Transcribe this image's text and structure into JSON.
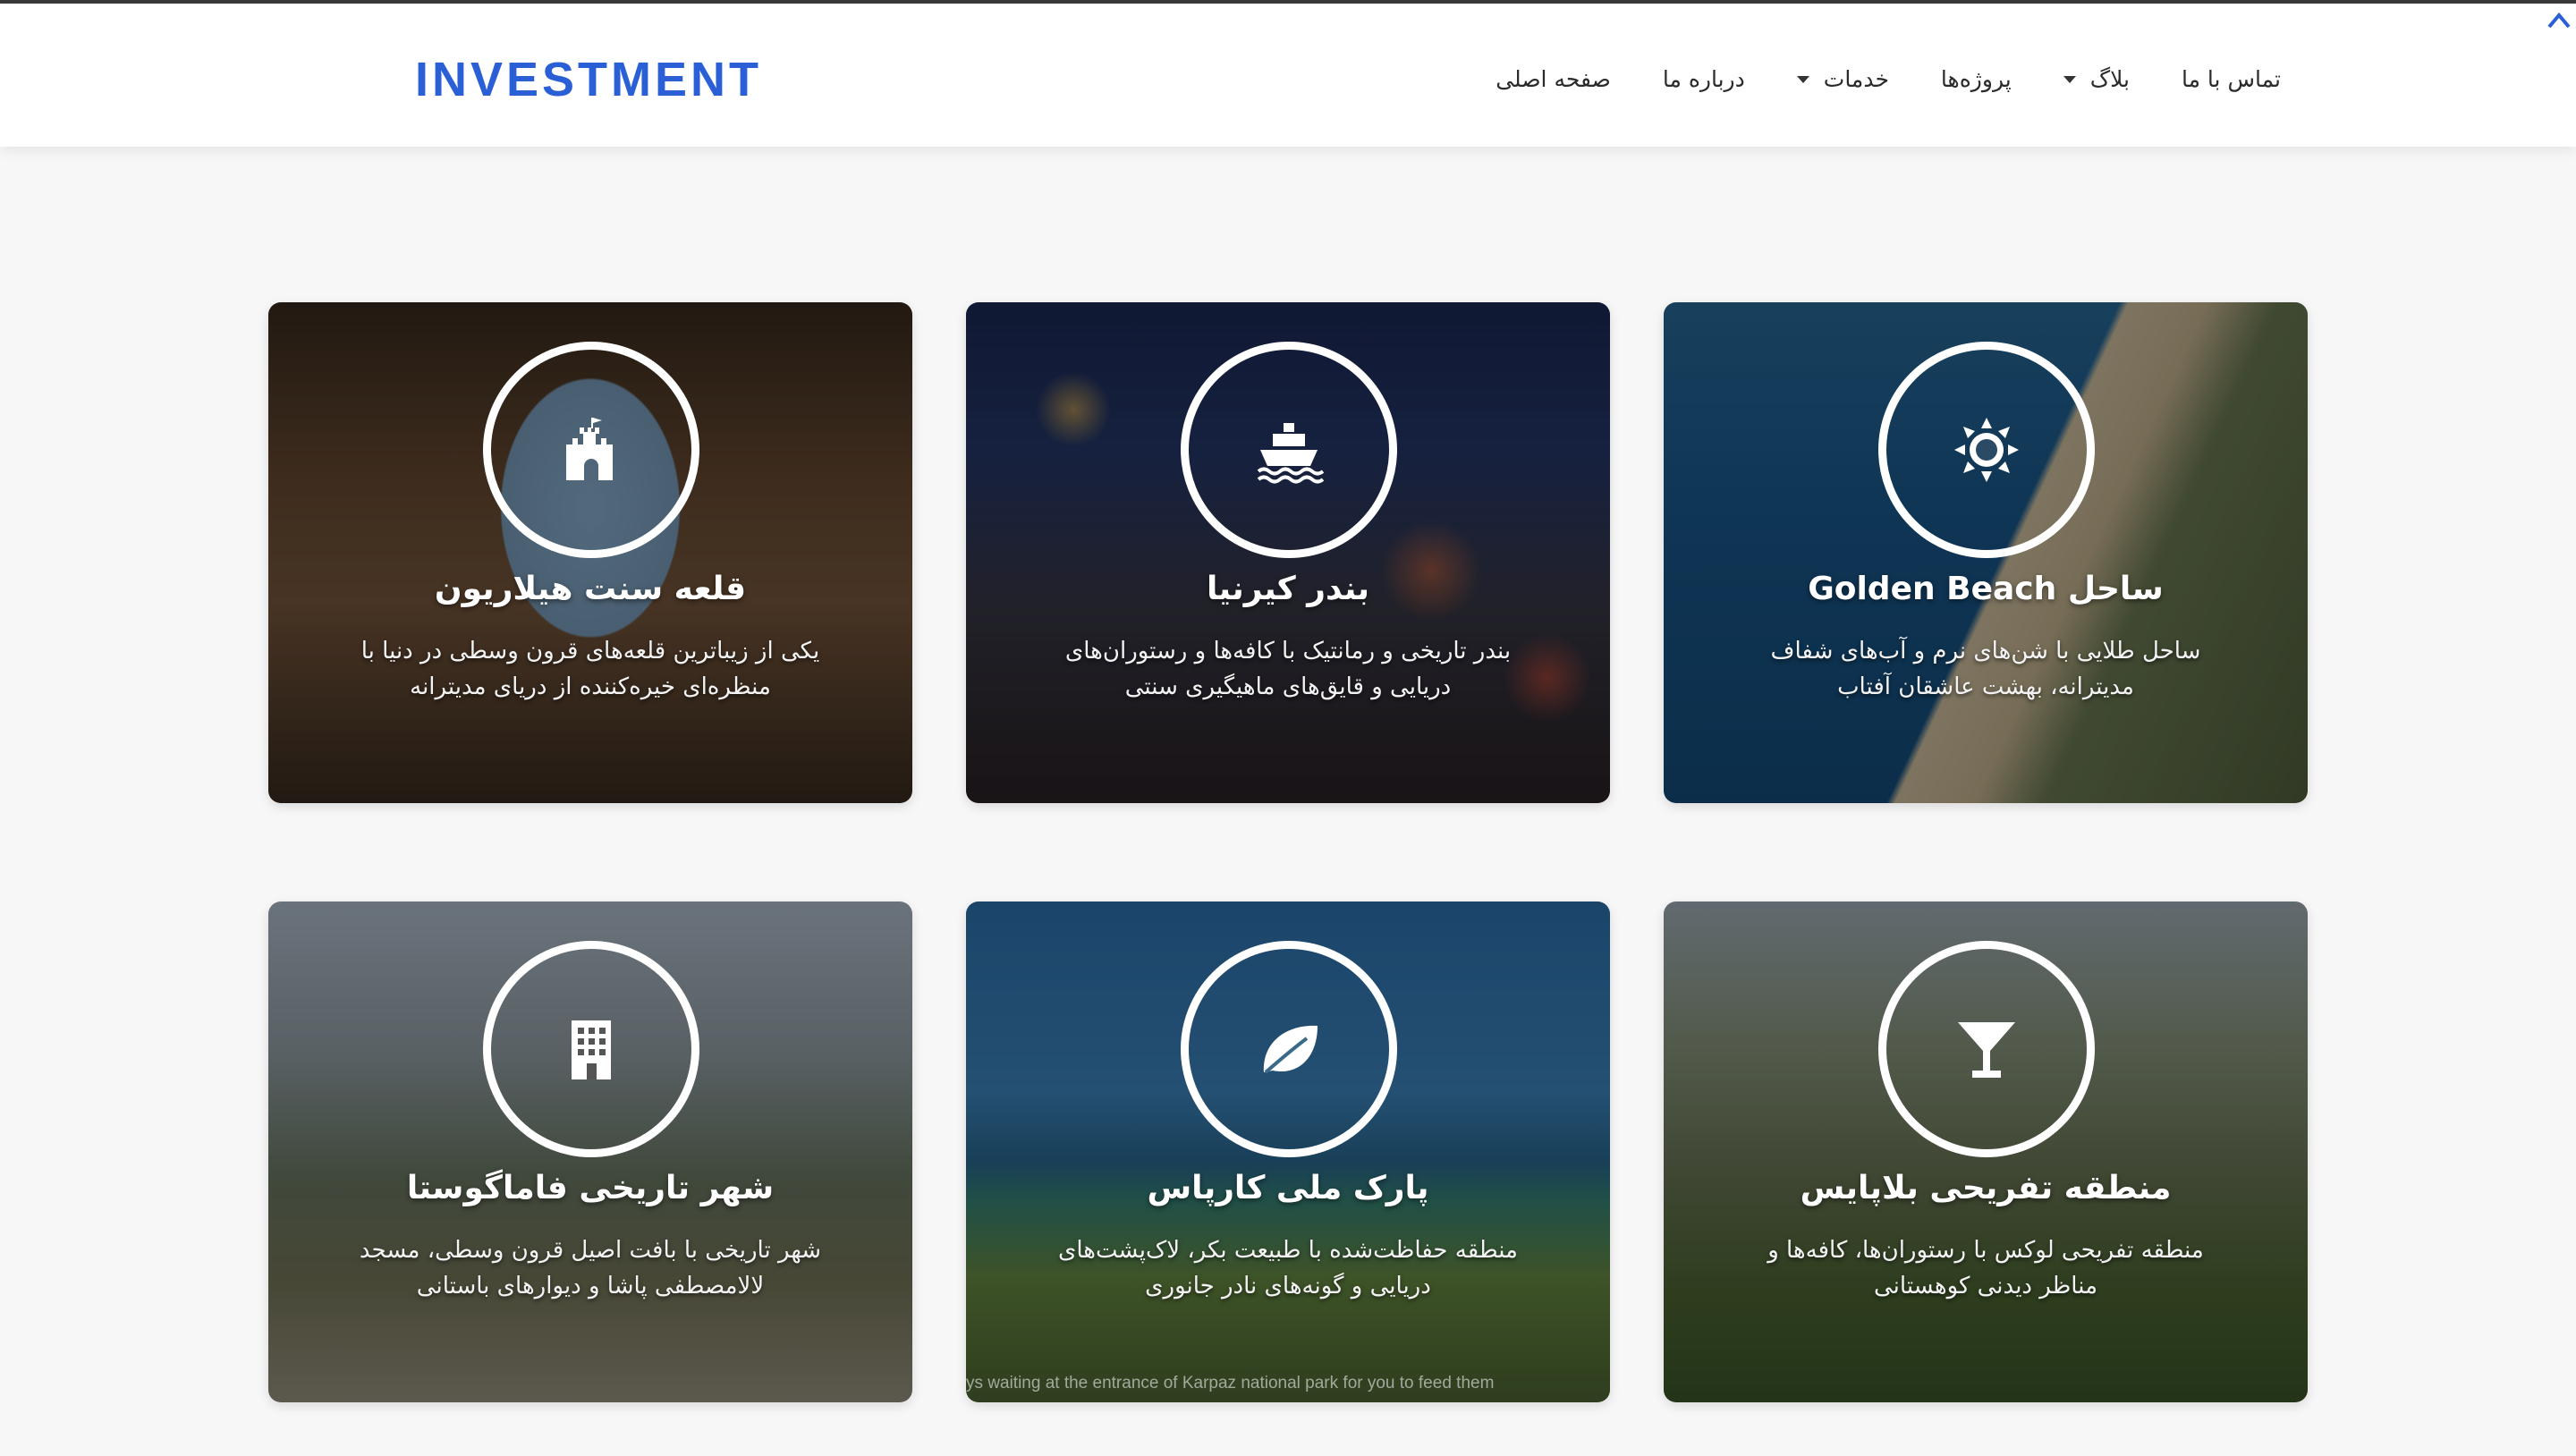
{
  "header": {
    "logo": "INVESTMENT",
    "nav": [
      {
        "label": "صفحه اصلی",
        "dropdown": false
      },
      {
        "label": "درباره ما",
        "dropdown": false
      },
      {
        "label": "خدمات",
        "dropdown": true
      },
      {
        "label": "پروژه‌ها",
        "dropdown": false
      },
      {
        "label": "بلاگ",
        "dropdown": true
      },
      {
        "label": "تماس با ما",
        "dropdown": false
      }
    ]
  },
  "cards": [
    {
      "icon": "castle-icon",
      "title": "قلعه سنت هیلاریون",
      "desc": "یکی از زیباترین قلعه‌های قرون وسطی در دنیا با منظره‌ای خیره‌کننده از دریای مدیترانه",
      "caption": ""
    },
    {
      "icon": "ship-icon",
      "title": "بندر کیرنیا",
      "desc": "بندر تاریخی و رمانتیک با کافه‌ها و رستوران‌های دریایی و قایق‌های ماهیگیری سنتی",
      "caption": ""
    },
    {
      "icon": "sun-icon",
      "title": "ساحل Golden Beach",
      "desc": "ساحل طلایی با شن‌های نرم و آب‌های شفاف مدیترانه، بهشت عاشقان آفتاب",
      "caption": ""
    },
    {
      "icon": "building-icon",
      "title": "شهر تاریخی فاماگوستا",
      "desc": "شهر تاریخی با بافت اصیل قرون وسطی، مسجد لالامصطفی پاشا و دیوارهای باستانی",
      "caption": ""
    },
    {
      "icon": "leaf-icon",
      "title": "پارک ملی کارپاس",
      "desc": "منطقه حفاظت‌شده با طبیعت بکر، لاک‌پشت‌های دریایی و گونه‌های نادر جانوری",
      "caption": "ys waiting at the entrance of Karpaz national park for you to feed them"
    },
    {
      "icon": "cocktail-icon",
      "title": "منطقه تفریحی بلاپایس",
      "desc": "منطقه تفریحی لوکس با رستوران‌ها، کافه‌ها و مناظر دیدنی کوهستانی",
      "caption": ""
    }
  ]
}
